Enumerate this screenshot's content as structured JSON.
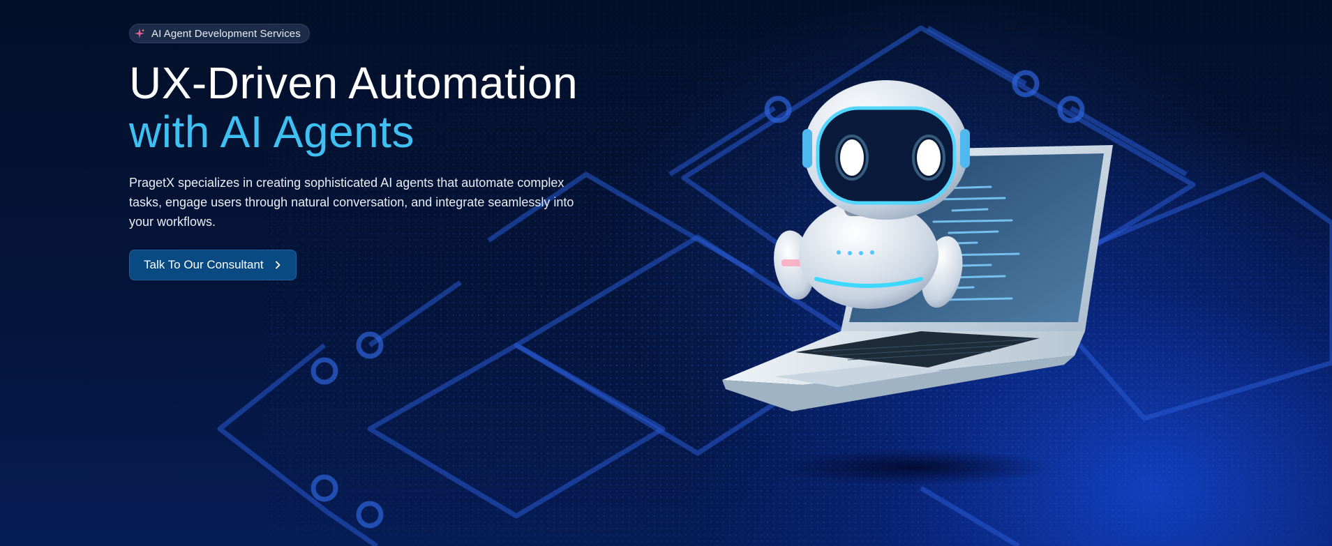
{
  "badge": {
    "label": "AI Agent Development Services",
    "icon": "sparkle-icon"
  },
  "headline": {
    "line1": "UX-Driven Automation",
    "line2": "with AI Agents"
  },
  "description": "PragetX specializes in creating sophisticated AI agents that automate complex tasks, engage users through natural conversation, and integrate seamlessly into your workflows.",
  "cta": {
    "label": "Talk To Our Consultant",
    "icon": "chevron-right-icon"
  },
  "colors": {
    "background": "#04143a",
    "accent": "#3fc0f2",
    "button": "#0a4a83",
    "text": "#ffffff"
  }
}
